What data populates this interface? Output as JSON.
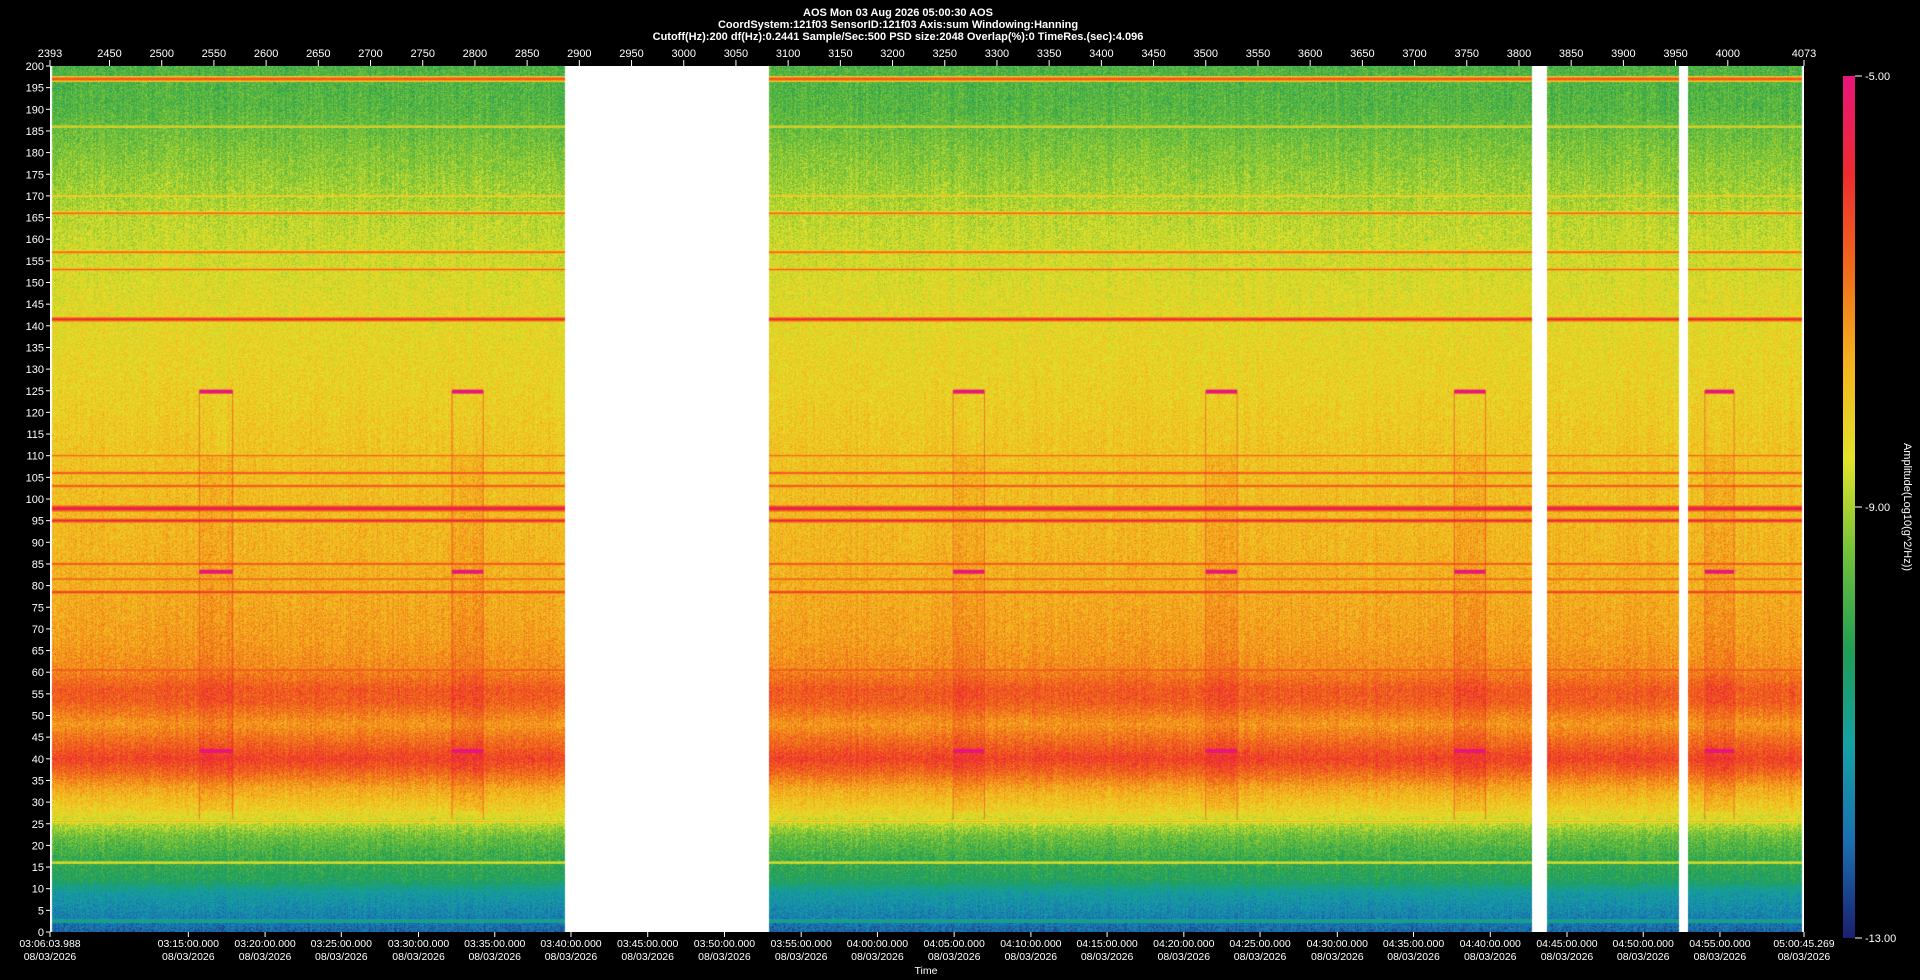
{
  "header": {
    "line1": "AOS   Mon 03 Aug 2026 05:00:30  AOS",
    "line2": "CoordSystem:121f03    SensorID:121f03    Axis:sum     Windowing:Hanning",
    "line3": "Cutoff(Hz):200      df(Hz):0.2441      Sample/Sec:500      PSD size:2048      Overlap(%):0       TimeRes.(sec):4.096"
  },
  "chart_data": {
    "type": "heatmap",
    "title": "AOS   Mon 03 Aug 2026 05:00:30  AOS",
    "ylabel": "",
    "xlabel": "Time",
    "ylim": [
      0,
      200
    ],
    "yticks": [
      0,
      5,
      10,
      15,
      20,
      25,
      30,
      35,
      40,
      45,
      50,
      55,
      60,
      65,
      70,
      75,
      80,
      85,
      90,
      95,
      100,
      105,
      110,
      115,
      120,
      125,
      130,
      135,
      140,
      145,
      150,
      155,
      160,
      165,
      170,
      175,
      180,
      185,
      190,
      195,
      200
    ],
    "top_axis": {
      "range": [
        2393,
        4073
      ],
      "ticks": [
        2393,
        2450,
        2500,
        2550,
        2600,
        2650,
        2700,
        2750,
        2800,
        2850,
        2900,
        2950,
        3000,
        3050,
        3100,
        3150,
        3200,
        3250,
        3300,
        3350,
        3400,
        3450,
        3500,
        3550,
        3600,
        3650,
        3700,
        3750,
        3800,
        3850,
        3900,
        3950,
        4000,
        4073
      ]
    },
    "time_labels": [
      {
        "idx": 2393,
        "time": "03:06:03.988",
        "date": "08/03/2026"
      },
      {
        "idx": 2525.5,
        "time": "03:15:00.000",
        "date": "08/03/2026"
      },
      {
        "idx": 2599,
        "time": "03:20:00.000",
        "date": "08/03/2026"
      },
      {
        "idx": 2672,
        "time": "03:25:00.000",
        "date": "08/03/2026"
      },
      {
        "idx": 2746,
        "time": "03:30:00.000",
        "date": "08/03/2026"
      },
      {
        "idx": 2819,
        "time": "03:35:00.000",
        "date": "08/03/2026"
      },
      {
        "idx": 2892,
        "time": "03:40:00.000",
        "date": "08/03/2026"
      },
      {
        "idx": 2965.5,
        "time": "03:45:00.000",
        "date": "08/03/2026"
      },
      {
        "idx": 3039,
        "time": "03:50:00.000",
        "date": "08/03/2026"
      },
      {
        "idx": 3112.5,
        "time": "03:55:00.000",
        "date": "08/03/2026"
      },
      {
        "idx": 3185.5,
        "time": "04:00:00.000",
        "date": "08/03/2026"
      },
      {
        "idx": 3259,
        "time": "04:05:00.000",
        "date": "08/03/2026"
      },
      {
        "idx": 3332.5,
        "time": "04:10:00.000",
        "date": "08/03/2026"
      },
      {
        "idx": 3405.5,
        "time": "04:15:00.000",
        "date": "08/03/2026"
      },
      {
        "idx": 3479,
        "time": "04:20:00.000",
        "date": "08/03/2026"
      },
      {
        "idx": 3552,
        "time": "04:25:00.000",
        "date": "08/03/2026"
      },
      {
        "idx": 3626,
        "time": "04:30:00.000",
        "date": "08/03/2026"
      },
      {
        "idx": 3699,
        "time": "04:35:00.000",
        "date": "08/03/2026"
      },
      {
        "idx": 3772.5,
        "time": "04:40:00.000",
        "date": "08/03/2026"
      },
      {
        "idx": 3846,
        "time": "04:45:00.000",
        "date": "08/03/2026"
      },
      {
        "idx": 3919,
        "time": "04:50:00.000",
        "date": "08/03/2026"
      },
      {
        "idx": 3992.5,
        "time": "04:55:00.000",
        "date": "08/03/2026"
      },
      {
        "idx": 4073,
        "time": "05:00:45.269",
        "date": "08/03/2026"
      }
    ],
    "colorbar": {
      "label": "Amplitude(Log10(g^2/Hz))",
      "range": [
        -13,
        -5
      ],
      "tick_labels": [
        "-5.00",
        "-9.00",
        "-13.00"
      ],
      "colors": [
        "#1a1f6e",
        "#1a6fb0",
        "#15a0a5",
        "#1f9e55",
        "#6fc03a",
        "#e3e32a",
        "#f5b21e",
        "#f06a1a",
        "#ee2a30",
        "#e8157a"
      ]
    },
    "data_gaps": [
      [
        2886,
        3082
      ],
      [
        3812,
        3827
      ],
      [
        3953,
        3962
      ]
    ],
    "background_profile": [
      {
        "hz": 0,
        "level": 0.1
      },
      {
        "hz": 4,
        "level": 0.16
      },
      {
        "hz": 9,
        "level": 0.22
      },
      {
        "hz": 12,
        "level": 0.33
      },
      {
        "hz": 17,
        "level": 0.37
      },
      {
        "hz": 22,
        "level": 0.44
      },
      {
        "hz": 28,
        "level": 0.6
      },
      {
        "hz": 33,
        "level": 0.68
      },
      {
        "hz": 37,
        "level": 0.79
      },
      {
        "hz": 40,
        "level": 0.85
      },
      {
        "hz": 44,
        "level": 0.78
      },
      {
        "hz": 48,
        "level": 0.71
      },
      {
        "hz": 53,
        "level": 0.8
      },
      {
        "hz": 56,
        "level": 0.81
      },
      {
        "hz": 61,
        "level": 0.73
      },
      {
        "hz": 67,
        "level": 0.7
      },
      {
        "hz": 80,
        "level": 0.67
      },
      {
        "hz": 95,
        "level": 0.65
      },
      {
        "hz": 110,
        "level": 0.63
      },
      {
        "hz": 125,
        "level": 0.6
      },
      {
        "hz": 140,
        "level": 0.58
      },
      {
        "hz": 150,
        "level": 0.56
      },
      {
        "hz": 165,
        "level": 0.52
      },
      {
        "hz": 180,
        "level": 0.46
      },
      {
        "hz": 190,
        "level": 0.41
      },
      {
        "hz": 200,
        "level": 0.4
      }
    ],
    "tones": [
      {
        "hz": 2.5,
        "level": 0.3,
        "w": 0.4
      },
      {
        "hz": 16,
        "level": 0.6,
        "w": 0.4
      },
      {
        "hz": 25.5,
        "level": 0.67,
        "w": 0.4
      },
      {
        "hz": 60.5,
        "level": 0.85,
        "w": 0.5
      },
      {
        "hz": 78.5,
        "level": 0.9,
        "w": 0.5
      },
      {
        "hz": 81.5,
        "level": 0.82,
        "w": 0.5
      },
      {
        "hz": 85,
        "level": 0.85,
        "w": 0.5
      },
      {
        "hz": 95,
        "level": 0.93,
        "w": 0.6
      },
      {
        "hz": 97.8,
        "level": 0.98,
        "w": 0.8
      },
      {
        "hz": 103,
        "level": 0.85,
        "w": 0.5
      },
      {
        "hz": 106,
        "level": 0.85,
        "w": 0.5
      },
      {
        "hz": 110,
        "level": 0.8,
        "w": 0.4
      },
      {
        "hz": 141.5,
        "level": 0.93,
        "w": 0.6
      },
      {
        "hz": 153,
        "level": 0.8,
        "w": 0.4
      },
      {
        "hz": 157,
        "level": 0.83,
        "w": 0.4
      },
      {
        "hz": 166,
        "level": 0.82,
        "w": 0.4
      },
      {
        "hz": 170,
        "level": 0.68,
        "w": 0.3
      },
      {
        "hz": 186,
        "level": 0.65,
        "w": 0.3
      },
      {
        "hz": 197,
        "level": 0.86,
        "w": 0.6
      }
    ],
    "events": [
      {
        "start": 2536,
        "end": 2568
      },
      {
        "start": 2778,
        "end": 2808
      },
      {
        "start": 3258,
        "end": 3288
      },
      {
        "start": 3500,
        "end": 3530
      },
      {
        "start": 3738,
        "end": 3768
      },
      {
        "start": 3978,
        "end": 4006
      }
    ],
    "event_marker_hz": [
      41.8,
      83.2,
      124.8
    ]
  }
}
